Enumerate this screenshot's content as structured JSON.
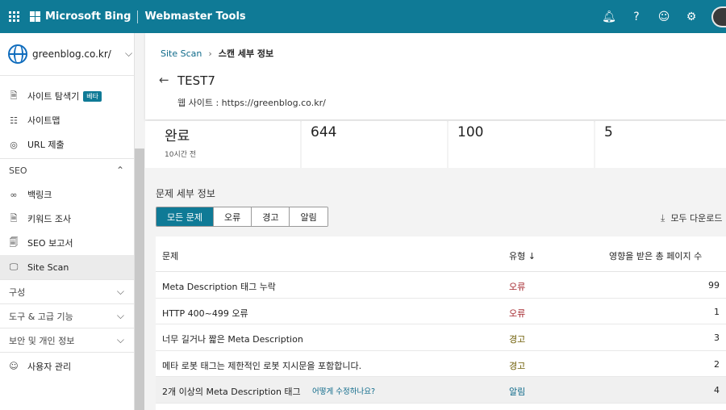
{
  "topbar": {
    "brand": "Microsoft Bing",
    "product": "Webmaster Tools",
    "icons": [
      "waffle-icon",
      "bell-icon",
      "help-icon",
      "smiley-icon",
      "gear-icon",
      "avatar"
    ]
  },
  "sidebar": {
    "site": "greenblog.co.kr/",
    "items": [
      {
        "label": "사이트 탐색기",
        "badge": "베타",
        "icon": "document-icon"
      },
      {
        "label": "사이트맵",
        "icon": "sitemap-icon"
      },
      {
        "label": "URL 제출",
        "icon": "globe-icon"
      }
    ],
    "seo_section": "SEO",
    "seo_items": [
      {
        "label": "백링크",
        "icon": "link-icon"
      },
      {
        "label": "키워드 조사",
        "icon": "document-icon"
      },
      {
        "label": "SEO 보고서",
        "icon": "report-icon"
      },
      {
        "label": "Site Scan",
        "icon": "scan-icon"
      }
    ],
    "sections": [
      "구성",
      "도구 & 고급 기능",
      "보안 및 개인 정보"
    ],
    "user_mgmt": "사용자 관리"
  },
  "header": {
    "breadcrumb_link": "Site Scan",
    "breadcrumb_current": "스캔 세부 정보",
    "scan_name": "TEST7",
    "site_line": "웹 사이트 : https://greenblog.co.kr/"
  },
  "stats": {
    "status": "완료",
    "status_sub": "10시간 전",
    "v1": "644",
    "v2": "100",
    "v3": "5"
  },
  "issues": {
    "title": "문제 세부 정보",
    "filters": [
      "모든 문제",
      "오류",
      "경고",
      "알림"
    ],
    "download_all": "모두 다운로드",
    "columns": {
      "issue": "문제",
      "type": "유형",
      "pages": "영향을 받은 총 페이지 수"
    },
    "how_fix": "어떻게 수정하나요?",
    "rows": [
      {
        "issue": "Meta Description 태그 누락",
        "type": "오류",
        "pages": "99"
      },
      {
        "issue": "HTTP 400~499 오류",
        "type": "오류",
        "pages": "1"
      },
      {
        "issue": "너무 길거나 짧은 Meta Description",
        "type": "경고",
        "pages": "3"
      },
      {
        "issue": "메타 로봇 태그는 제한적인 로봇 지시문을 포함합니다.",
        "type": "경고",
        "pages": "2"
      },
      {
        "issue": "2개 이상의 Meta Description 태그",
        "type": "알림",
        "pages": "4"
      }
    ]
  },
  "colors": {
    "accent": "#0f7a96",
    "error": "#a4262c",
    "warning": "#6b5a00",
    "info": "#0f6a8a"
  }
}
